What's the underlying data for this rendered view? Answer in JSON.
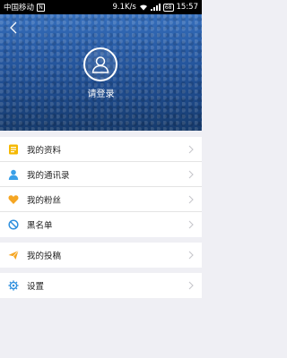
{
  "status_bar": {
    "carrier": "中国移动",
    "notification": "N",
    "speed": "9.1K/s",
    "battery": "68",
    "time": "15:57"
  },
  "header": {
    "login_label": "请登录"
  },
  "menu_group_1": [
    {
      "label": "我的资料",
      "icon": "profile-card-icon",
      "color": "#f5b800"
    },
    {
      "label": "我的通讯录",
      "icon": "contacts-icon",
      "color": "#3aa0e8"
    },
    {
      "label": "我的粉丝",
      "icon": "heart-icon",
      "color": "#f5a623"
    },
    {
      "label": "黑名单",
      "icon": "block-icon",
      "color": "#2e8fde"
    }
  ],
  "menu_group_2": [
    {
      "label": "我的投稿",
      "icon": "paper-plane-icon",
      "color": "#f5a623"
    }
  ],
  "menu_group_3": [
    {
      "label": "设置",
      "icon": "gear-icon",
      "color": "#2e8fde"
    }
  ]
}
